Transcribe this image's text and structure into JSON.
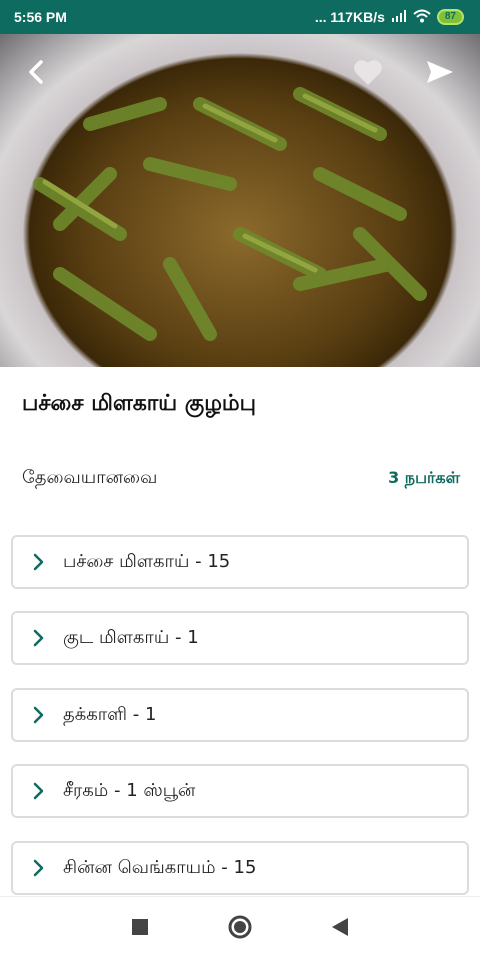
{
  "status": {
    "time": "5:56 PM",
    "network_speed": "... 117KB/s",
    "battery": "87"
  },
  "header": {
    "back_icon": "chevron-left-icon",
    "favorite_icon": "heart-icon",
    "share_icon": "send-icon"
  },
  "recipe": {
    "title": "பச்சை மிளகாய் குழம்பு",
    "requirements_label": "தேவையானவை",
    "servings": "3 நபர்கள்"
  },
  "ingredients": [
    "பச்சை மிளகாய் - 15",
    "குட மிளகாய் - 1",
    "தக்காளி - 1",
    "சீரகம் - 1 ஸ்பூன்",
    "சின்ன வெங்காயம் - 15"
  ],
  "colors": {
    "primary": "#0e6b5f",
    "card_border": "#dcdcdc"
  }
}
